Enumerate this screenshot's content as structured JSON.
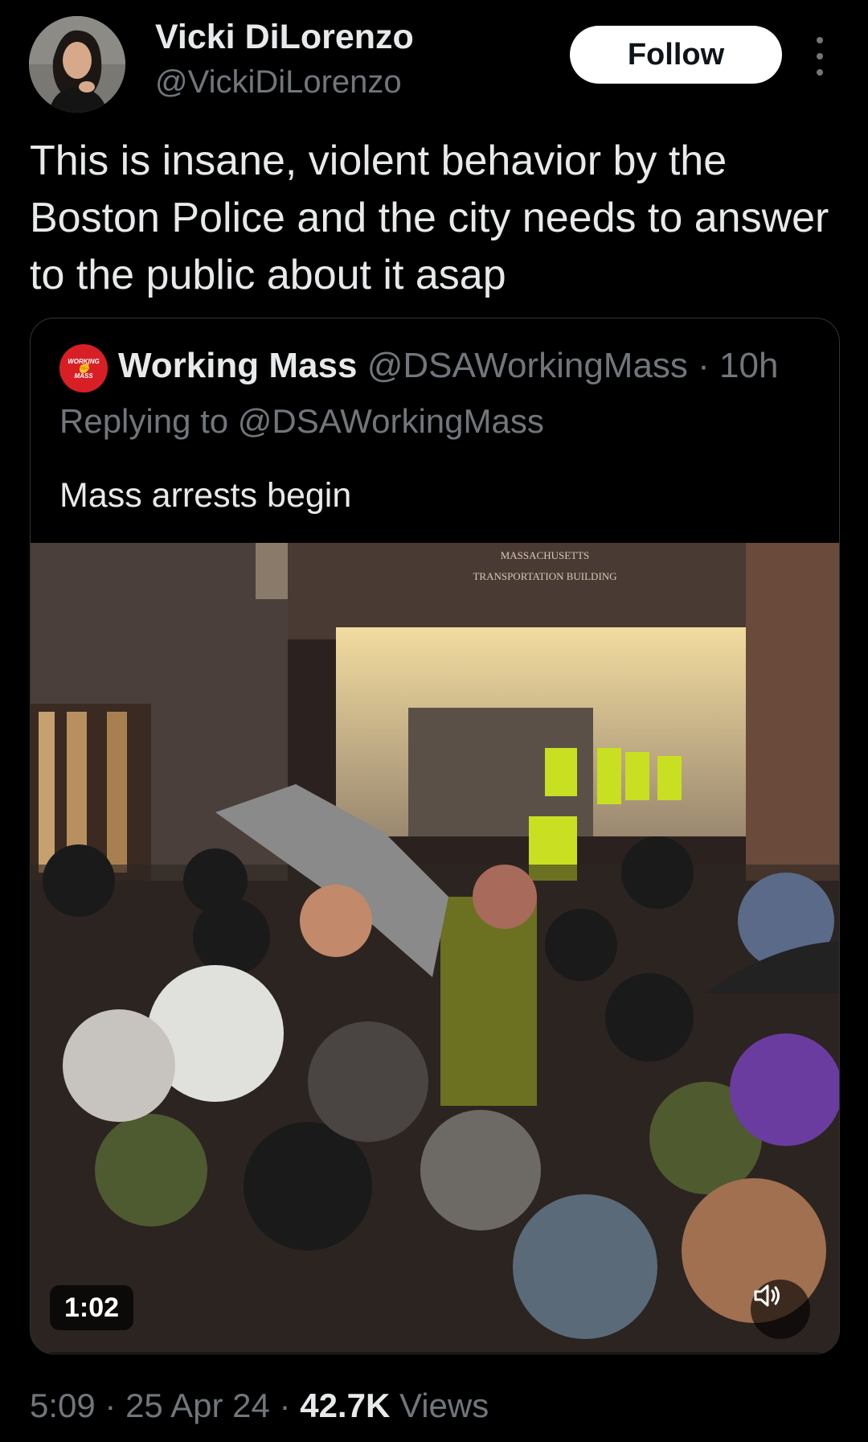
{
  "author": {
    "name": "Vicki DiLorenzo",
    "handle": "@VickiDiLorenzo",
    "avatar_icon": "profile-photo"
  },
  "follow_label": "Follow",
  "more_icon": "vertical-ellipsis-icon",
  "tweet_text": "This is insane, violent behavior by the Boston Police and the city needs to answer to the public about it asap",
  "quoted_tweet": {
    "avatar_text": [
      "WORKING",
      "MASS"
    ],
    "name": "Working Mass",
    "handle": "@DSAWorkingMass",
    "separator": " · ",
    "time": "10h",
    "replying_prefix": "Replying to ",
    "replying_handle": "@DSAWorkingMass",
    "text": "Mass arrests begin",
    "video": {
      "sign_line1": "MASSACHUSETTS",
      "sign_line2": "TRANSPORTATION BUILDING",
      "duration": "1:02",
      "mute_icon": "speaker-muted-icon"
    }
  },
  "footer": {
    "time": "5:09",
    "sep1": " · ",
    "date": "25 Apr 24",
    "sep2": " · ",
    "views_count": "42.7K",
    "views_label": " Views"
  },
  "colors": {
    "background": "#000000",
    "text_primary": "#e7e9ea",
    "text_secondary": "#71767b",
    "follow_bg": "#ffffff",
    "border": "#2f3336",
    "hi_vis": "#c8e021"
  }
}
